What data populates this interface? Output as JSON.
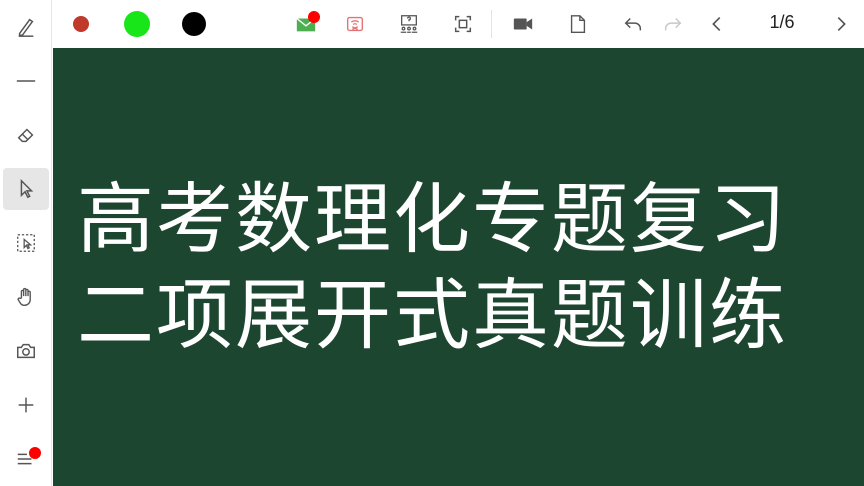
{
  "toolbar": {
    "colors": [
      "#c0392b",
      "#19e619",
      "#000000"
    ],
    "page_indicator": "1/6",
    "icons": [
      "mail-icon",
      "screen-off-icon",
      "classroom-icon",
      "fullscreen-icon",
      "video-camera-icon",
      "document-icon",
      "undo-icon",
      "redo-icon",
      "prev-page-icon",
      "next-page-icon"
    ]
  },
  "sidebar": {
    "tools": [
      "pen-icon",
      "line-icon",
      "eraser-icon",
      "pointer-icon",
      "lasso-select-icon",
      "hand-icon",
      "camera-icon",
      "add-icon",
      "menu-list-icon"
    ]
  },
  "board": {
    "background": "#1d4631",
    "line1": "高考数理化专题复习",
    "line2": "二项展开式真题训练"
  }
}
